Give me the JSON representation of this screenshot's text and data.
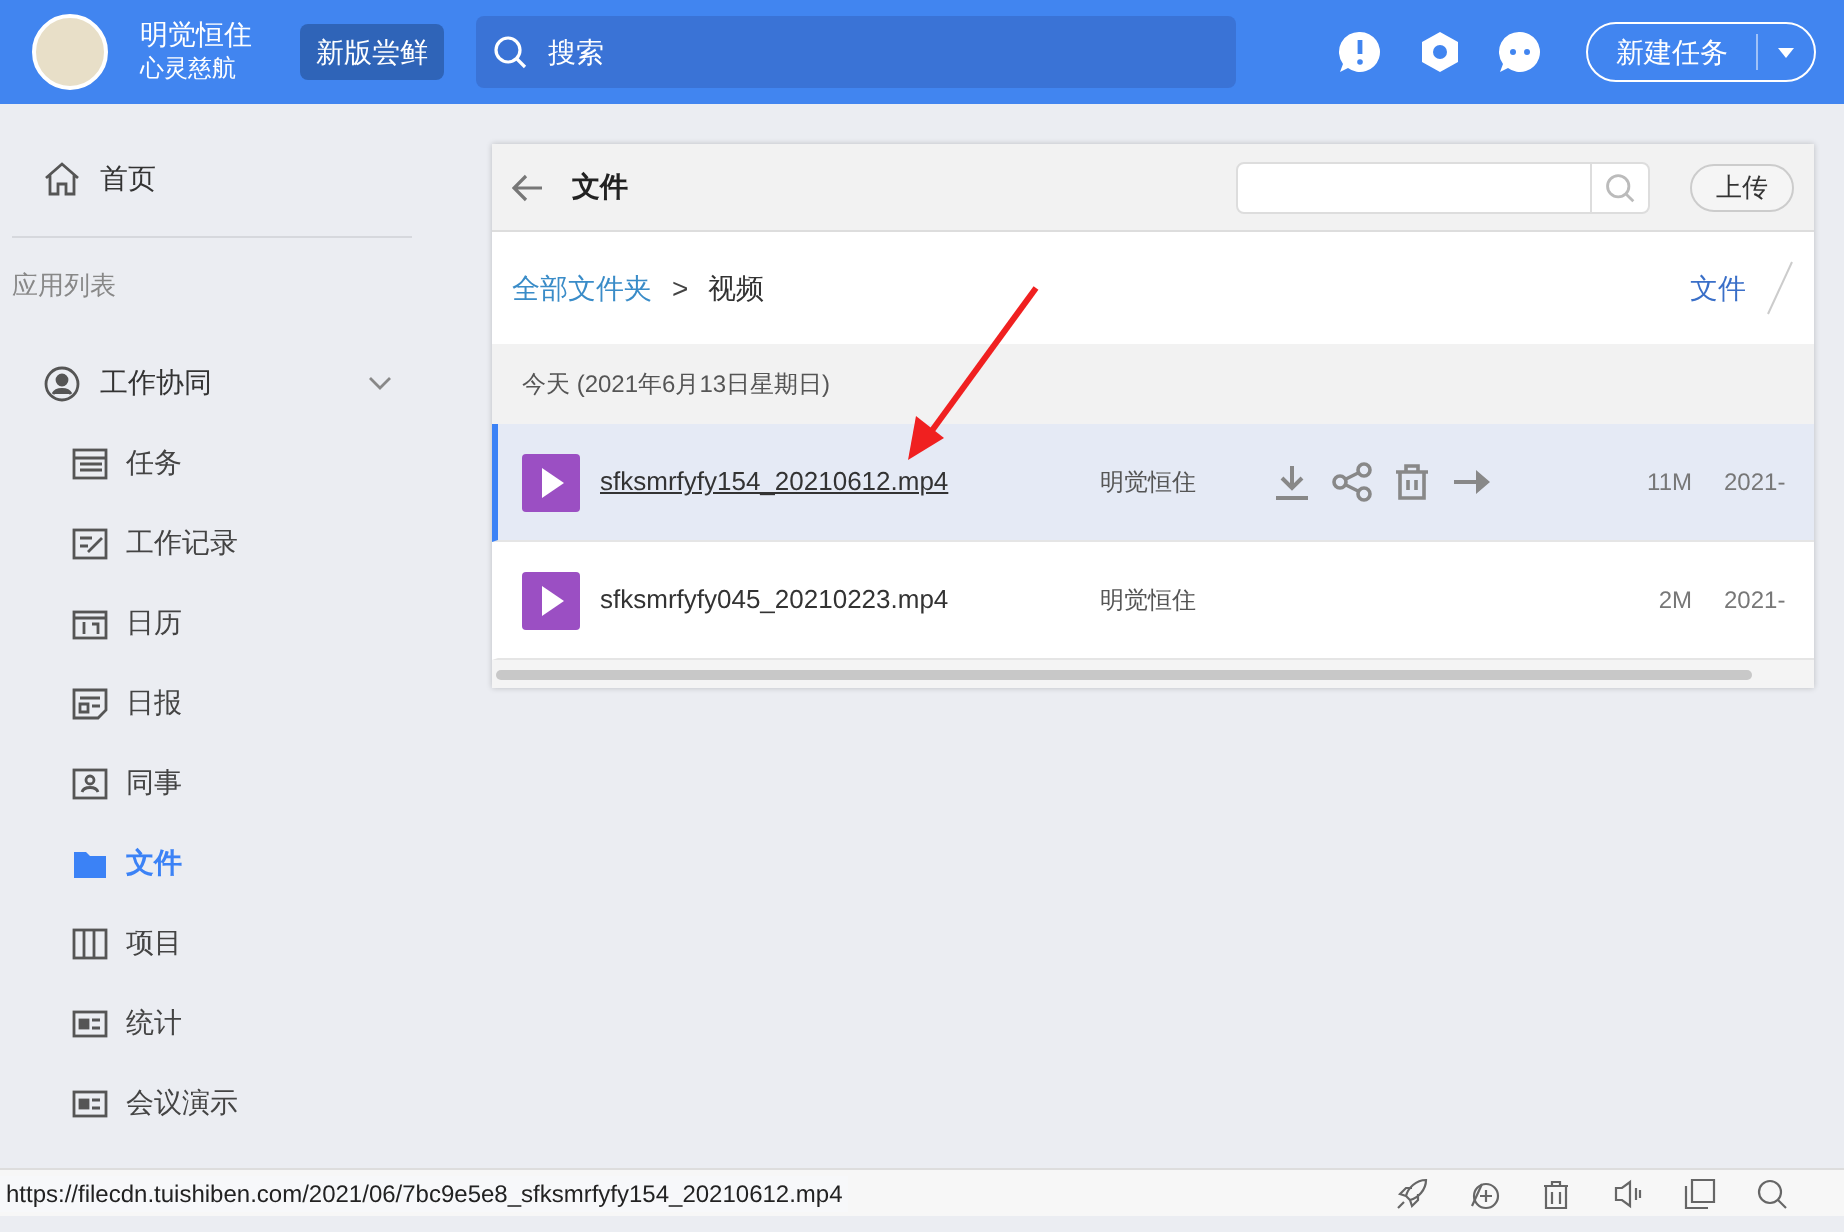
{
  "header": {
    "user_name": "明觉恒住",
    "user_subtitle": "心灵慈航",
    "new_version_button": "新版尝鲜",
    "search": {
      "placeholder": "搜索"
    },
    "new_task_button": "新建任务"
  },
  "sidebar": {
    "home": "首页",
    "section_label": "应用列表",
    "group": {
      "label": "工作协同",
      "expanded": true,
      "items": [
        {
          "label": "任务",
          "selected": false
        },
        {
          "label": "工作记录",
          "selected": false
        },
        {
          "label": "日历",
          "selected": false
        },
        {
          "label": "日报",
          "selected": false
        },
        {
          "label": "同事",
          "selected": false
        },
        {
          "label": "文件",
          "selected": true
        },
        {
          "label": "项目",
          "selected": false
        },
        {
          "label": "统计",
          "selected": false
        },
        {
          "label": "会议演示",
          "selected": false
        }
      ]
    }
  },
  "panel": {
    "title": "文件",
    "upload_button": "上传",
    "breadcrumb": [
      "全部文件夹",
      "视频"
    ],
    "breadcrumb_separator": ">",
    "view_label": "文件",
    "date_group": "今天 (2021年6月13日星期日)",
    "files": [
      {
        "name": "sfksmrfyfy154_20210612.mp4",
        "owner": "明觉恒住",
        "size": "11M",
        "date": "2021-",
        "selected": true
      },
      {
        "name": "sfksmrfyfy045_20210223.mp4",
        "owner": "明觉恒住",
        "size": "2M",
        "date": "2021-",
        "selected": false
      }
    ]
  },
  "status_bar": {
    "url": "https://filecdn.tuishiben.com/2021/06/7bc9e5e8_sfksmrfyfy154_20210612.mp4"
  }
}
